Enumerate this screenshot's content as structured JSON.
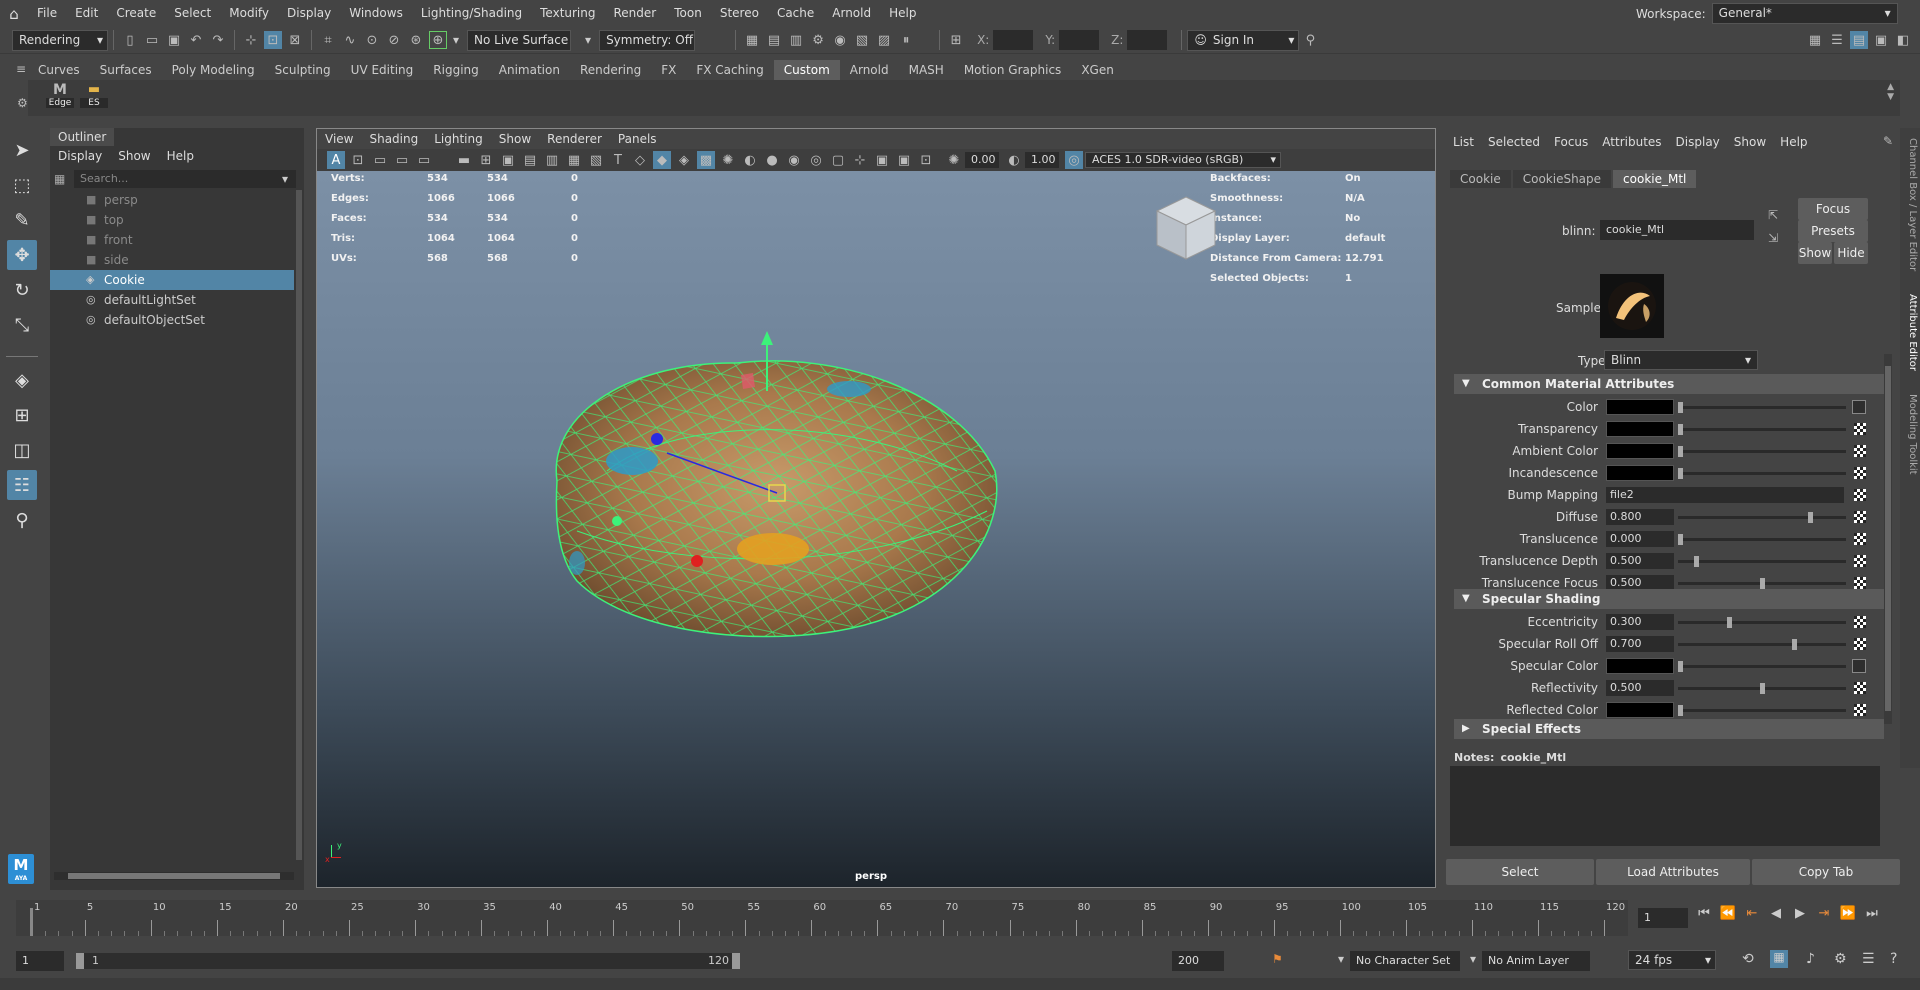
{
  "menubar": {
    "items": [
      "File",
      "Edit",
      "Create",
      "Select",
      "Modify",
      "Display",
      "Windows",
      "Lighting/Shading",
      "Texturing",
      "Render",
      "Toon",
      "Stereo",
      "Cache",
      "Arnold",
      "Help"
    ],
    "workspace_label": "Workspace:",
    "workspace_value": "General*"
  },
  "statusline": {
    "menuset": "Rendering",
    "live_surface": "No Live Surface",
    "symmetry": "Symmetry: Off",
    "x_label": "X:",
    "y_label": "Y:",
    "z_label": "Z:",
    "sign_in": "Sign In"
  },
  "shelf": {
    "tabs": [
      "Curves",
      "Surfaces",
      "Poly Modeling",
      "Sculpting",
      "UV Editing",
      "Rigging",
      "Animation",
      "Rendering",
      "FX",
      "FX Caching",
      "Custom",
      "Arnold",
      "MASH",
      "Motion Graphics",
      "XGen"
    ],
    "active_tab": "Custom",
    "buttons": [
      "Edge",
      "ES"
    ]
  },
  "outliner": {
    "title": "Outliner",
    "menu": [
      "Display",
      "Show",
      "Help"
    ],
    "search_placeholder": "Search...",
    "items": [
      {
        "label": "persp",
        "icon": "camera-icon",
        "dim": true
      },
      {
        "label": "top",
        "icon": "camera-icon",
        "dim": true
      },
      {
        "label": "front",
        "icon": "camera-icon",
        "dim": true
      },
      {
        "label": "side",
        "icon": "camera-icon",
        "dim": true
      },
      {
        "label": "Cookie",
        "icon": "mesh-icon",
        "selected": true
      },
      {
        "label": "defaultLightSet",
        "icon": "set-icon"
      },
      {
        "label": "defaultObjectSet",
        "icon": "set-icon"
      }
    ]
  },
  "viewport": {
    "menu": [
      "View",
      "Shading",
      "Lighting",
      "Show",
      "Renderer",
      "Panels"
    ],
    "exposure": "0.00",
    "gamma": "1.00",
    "color_space": "ACES 1.0 SDR-video (sRGB)",
    "camera_label": "persp",
    "hud_left": [
      {
        "label": "Verts:",
        "a": "534",
        "b": "534",
        "c": "0"
      },
      {
        "label": "Edges:",
        "a": "1066",
        "b": "1066",
        "c": "0"
      },
      {
        "label": "Faces:",
        "a": "534",
        "b": "534",
        "c": "0"
      },
      {
        "label": "Tris:",
        "a": "1064",
        "b": "1064",
        "c": "0"
      },
      {
        "label": "UVs:",
        "a": "568",
        "b": "568",
        "c": "0"
      }
    ],
    "hud_right": [
      {
        "label": "Backfaces:",
        "value": "On"
      },
      {
        "label": "Smoothness:",
        "value": "N/A"
      },
      {
        "label": "Instance:",
        "value": "No"
      },
      {
        "label": "Display Layer:",
        "value": "default"
      },
      {
        "label": "Distance From Camera:",
        "value": "12.791"
      },
      {
        "label": "Selected Objects:",
        "value": "1"
      }
    ]
  },
  "attribute_editor": {
    "menu": [
      "List",
      "Selected",
      "Focus",
      "Attributes",
      "Display",
      "Show",
      "Help"
    ],
    "tabs": [
      "Cookie",
      "CookieShape",
      "cookie_Mtl"
    ],
    "active_tab": "cookie_Mtl",
    "node_type_label": "blinn:",
    "node_name": "cookie_Mtl",
    "focus": "Focus",
    "presets": "Presets",
    "show": "Show",
    "hide": "Hide",
    "sample_label": "Sample",
    "type_label": "Type",
    "type_value": "Blinn",
    "sections": {
      "common": "Common Material Attributes",
      "specular": "Specular Shading",
      "special": "Special Effects"
    },
    "common_attrs": [
      {
        "label": "Color",
        "kind": "color",
        "knob": 0.0
      },
      {
        "label": "Transparency",
        "kind": "color",
        "knob": 0.0
      },
      {
        "label": "Ambient Color",
        "kind": "color",
        "knob": 0.0
      },
      {
        "label": "Incandescence",
        "kind": "color",
        "knob": 0.0
      },
      {
        "label": "Bump Mapping",
        "kind": "map",
        "value": "file2"
      },
      {
        "label": "Diffuse",
        "kind": "num",
        "value": "0.800",
        "knob": 0.8
      },
      {
        "label": "Translucence",
        "kind": "num",
        "value": "0.000",
        "knob": 0.0
      },
      {
        "label": "Translucence Depth",
        "kind": "num",
        "value": "0.500",
        "knob": 0.1
      },
      {
        "label": "Translucence Focus",
        "kind": "num",
        "value": "0.500",
        "knob": 0.5
      }
    ],
    "specular_attrs": [
      {
        "label": "Eccentricity",
        "kind": "num",
        "value": "0.300",
        "knob": 0.3
      },
      {
        "label": "Specular Roll Off",
        "kind": "num",
        "value": "0.700",
        "knob": 0.7
      },
      {
        "label": "Specular Color",
        "kind": "color",
        "knob": 0.0
      },
      {
        "label": "Reflectivity",
        "kind": "num",
        "value": "0.500",
        "knob": 0.5
      },
      {
        "label": "Reflected Color",
        "kind": "color",
        "knob": 0.0
      }
    ],
    "notes_label": "Notes:",
    "notes_node": "cookie_Mtl",
    "bottom_buttons": [
      "Select",
      "Load Attributes",
      "Copy Tab"
    ],
    "side_tabs": [
      "Channel Box / Layer Editor",
      "Attribute Editor",
      "Modeling Toolkit"
    ]
  },
  "timeline": {
    "ticks": [
      "1",
      "5",
      "10",
      "15",
      "20",
      "25",
      "30",
      "35",
      "40",
      "45",
      "50",
      "55",
      "60",
      "65",
      "70",
      "75",
      "80",
      "85",
      "90",
      "95",
      "100",
      "105",
      "110",
      "115",
      "120"
    ],
    "current_frame": "1"
  },
  "range": {
    "start": "1",
    "inner_start": "1",
    "inner_end": "120",
    "end": "200",
    "character_set": "No Character Set",
    "anim_layer": "No Anim Layer",
    "fps": "24 fps"
  }
}
